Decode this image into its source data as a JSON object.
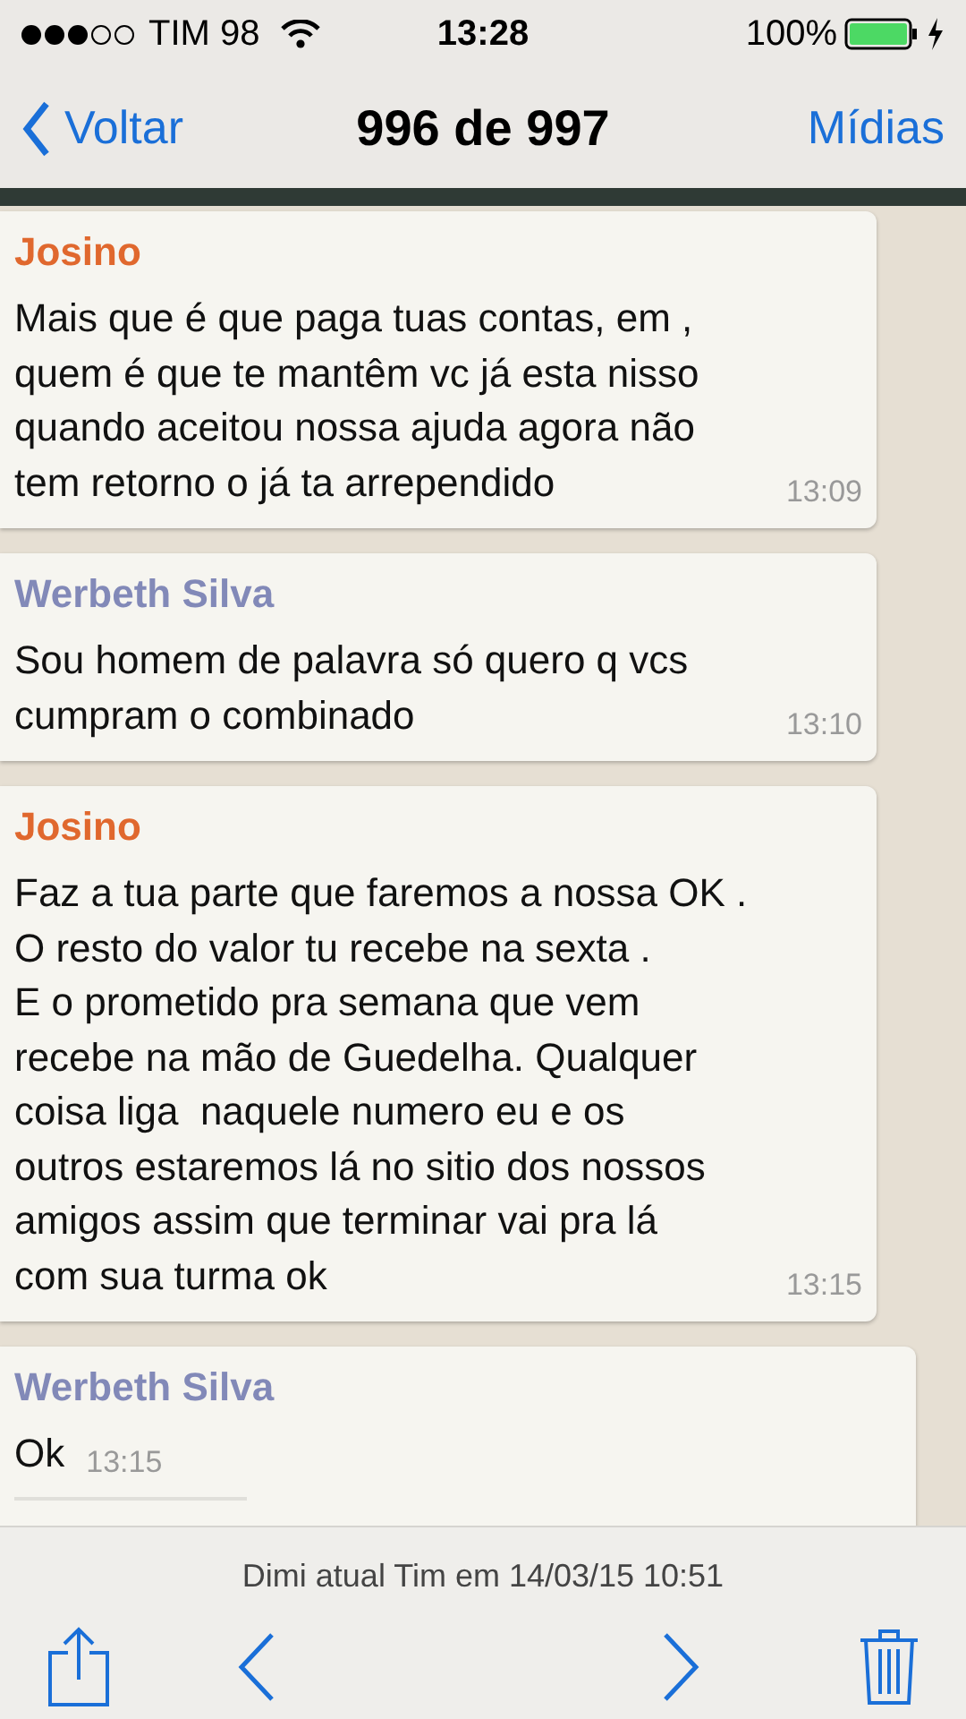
{
  "status_bar": {
    "carrier": "TIM 98",
    "time": "13:28",
    "battery": "100%"
  },
  "nav": {
    "back": "Voltar",
    "title": "996 de 997",
    "action": "Mídias"
  },
  "messages": [
    {
      "sender": "Josino",
      "color": "#e0682e",
      "kind": "block",
      "text": "Mais que é que paga tuas contas, em ,\nquem é que te mantêm vc já esta nisso\nquando aceitou nossa ajuda agora não\ntem retorno o já ta arrependido",
      "time": "13:09"
    },
    {
      "sender": "Werbeth Silva",
      "color": "#8289b8",
      "kind": "block",
      "text": "Sou homem de palavra só quero q vcs\ncumpram o combinado",
      "time": "13:10"
    },
    {
      "sender": "Josino",
      "color": "#e0682e",
      "kind": "block",
      "text": "Faz a tua parte que faremos a nossa OK .\nO resto do valor tu recebe na sexta .\nE o prometido pra semana que vem\nrecebe na mão de Guedelha. Qualquer\ncoisa liga  naquele numero eu e os\noutros estaremos lá no sitio dos nossos\namigos assim que terminar vai pra lá\ncom sua turma ok",
      "time": "13:15"
    },
    {
      "sender": "Werbeth Silva",
      "color": "#8289b8",
      "kind": "inline",
      "text": "Ok",
      "time": "13:15"
    }
  ],
  "toolbar": {
    "caption": "Dimi atual Tim em 14/03/15 10:51"
  }
}
